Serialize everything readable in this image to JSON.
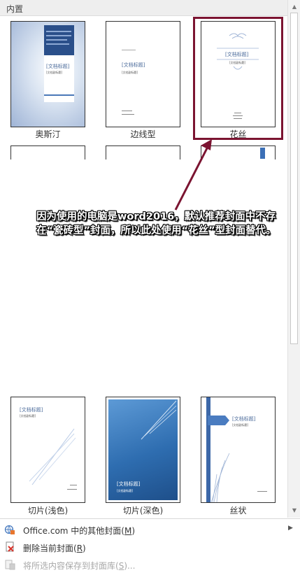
{
  "header": {
    "title": "内置"
  },
  "gallery": {
    "items": [
      {
        "caption": "奥斯汀",
        "cover_title": "[文档标题]",
        "cover_subtitle": "[文档副标题]"
      },
      {
        "caption": "边线型",
        "cover_title": "[文档标题]",
        "cover_subtitle": "[文档副标题]"
      },
      {
        "caption": "花丝",
        "cover_title": "[文档标题]",
        "cover_subtitle": "[文档副标题]"
      },
      {
        "caption": "切片(浅色)",
        "cover_title": "[文档标题]",
        "cover_subtitle": "[文档副标题]"
      },
      {
        "caption": "切片(深色)",
        "cover_title": "[文档标题]",
        "cover_subtitle": "[文档副标题]"
      },
      {
        "caption": "丝状",
        "cover_title": "[文档标题]",
        "cover_subtitle": "[文档副标题]"
      }
    ]
  },
  "annotation": {
    "text": "因为使用的电脑是word2016，默认推荐封面中不存在“瓷砖型”封面，所以此处使用“花丝”型封面替代。",
    "highlight_color": "#7b1431"
  },
  "menu": {
    "items": [
      {
        "label_prefix": "Office.com 中的其他封面(",
        "hotkey": "M",
        "label_suffix": ")",
        "icon": "office-globe-icon",
        "enabled": true,
        "has_submenu": true
      },
      {
        "label_prefix": "删除当前封面(",
        "hotkey": "R",
        "label_suffix": ")",
        "icon": "delete-page-icon",
        "enabled": true,
        "has_submenu": false
      },
      {
        "label_prefix": "将所选内容保存到封面库(",
        "hotkey": "S",
        "label_suffix": ")...",
        "icon": "save-selection-icon",
        "enabled": false,
        "has_submenu": false
      }
    ]
  }
}
